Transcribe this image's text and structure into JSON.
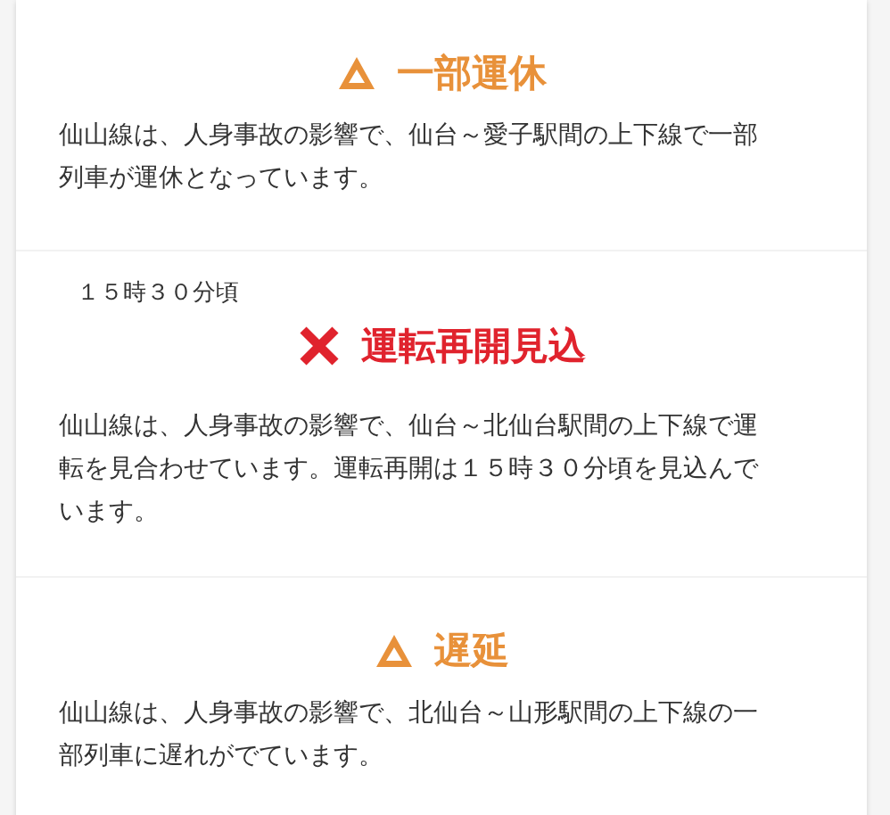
{
  "notices": [
    {
      "kind": "warning",
      "title": "一部運休",
      "text": "仙山線は、人身事故の影響で、仙台～愛子駅間の上下線で一部列車が運休となっています。"
    },
    {
      "kind": "stop",
      "time": "１５時３０分頃",
      "title": "運転再開見込",
      "text": "仙山線は、人身事故の影響で、仙台～北仙台駅間の上下線で運転を見合わせています。運転再開は１５時３０分頃を見込んでいます。"
    },
    {
      "kind": "warning",
      "title": "遅延",
      "text": "仙山線は、人身事故の影響で、北仙台～山形駅間の上下線の一部列車に遅れがでています。"
    }
  ]
}
